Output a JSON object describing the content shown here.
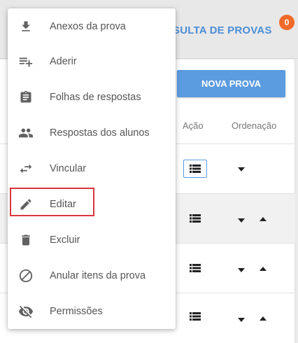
{
  "header": {
    "title": "SULTA DE PROVAS",
    "notification_count": "0"
  },
  "actions": {
    "new_button_label": "NOVA PROVA"
  },
  "table": {
    "columns": [
      "Ação",
      "Ordenação"
    ]
  },
  "menu": {
    "items": [
      {
        "label": "Anexos da prova",
        "icon": "download-icon"
      },
      {
        "label": "Aderir",
        "icon": "playlist-add-icon"
      },
      {
        "label": "Folhas de respostas",
        "icon": "clipboard-icon"
      },
      {
        "label": "Respostas dos alunos",
        "icon": "people-icon"
      },
      {
        "label": "Vincular",
        "icon": "swap-horiz-icon"
      },
      {
        "label": "Editar",
        "icon": "pencil-icon"
      },
      {
        "label": "Excluir",
        "icon": "trash-icon"
      },
      {
        "label": "Anular itens da prova",
        "icon": "block-icon"
      },
      {
        "label": "Permissões",
        "icon": "eye-off-icon"
      }
    ]
  },
  "colors": {
    "accent": "#5b9be0",
    "title": "#4a8ed6",
    "badge": "#f06a2a",
    "highlight": "#d9363e"
  }
}
